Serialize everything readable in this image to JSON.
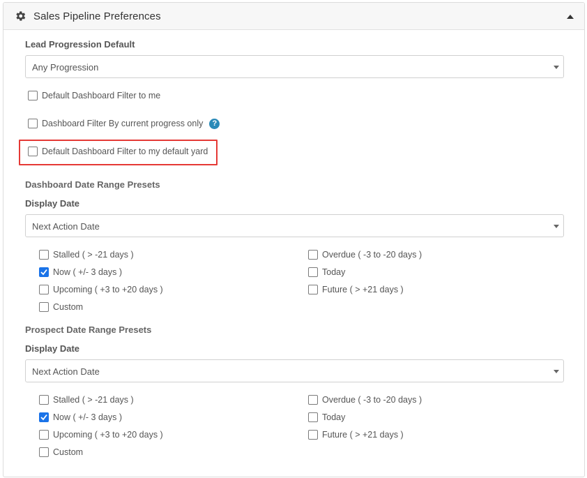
{
  "panel": {
    "title": "Sales Pipeline Preferences"
  },
  "lead_progression": {
    "label": "Lead Progression Default",
    "selected": "Any Progression"
  },
  "options": {
    "filter_to_me": {
      "label": "Default Dashboard Filter to me",
      "checked": false
    },
    "filter_current_progress": {
      "label": "Dashboard Filter By current progress only",
      "checked": false,
      "help": "?"
    },
    "filter_default_yard": {
      "label": "Default Dashboard Filter to my default yard",
      "checked": false
    }
  },
  "dashboard_presets": {
    "heading": "Dashboard Date Range Presets",
    "display_date_label": "Display Date",
    "display_date_selected": "Next Action Date",
    "items": [
      {
        "label": "Stalled ( > -21 days )",
        "checked": false
      },
      {
        "label": "Overdue ( -3 to -20 days )",
        "checked": false
      },
      {
        "label": "Now ( +/- 3 days )",
        "checked": true
      },
      {
        "label": "Today",
        "checked": false
      },
      {
        "label": "Upcoming ( +3 to +20 days )",
        "checked": false
      },
      {
        "label": "Future ( > +21 days )",
        "checked": false
      },
      {
        "label": "Custom",
        "checked": false
      }
    ]
  },
  "prospect_presets": {
    "heading": "Prospect Date Range Presets",
    "display_date_label": "Display Date",
    "display_date_selected": "Next Action Date",
    "items": [
      {
        "label": "Stalled ( > -21 days )",
        "checked": false
      },
      {
        "label": "Overdue ( -3 to -20 days )",
        "checked": false
      },
      {
        "label": "Now ( +/- 3 days )",
        "checked": true
      },
      {
        "label": "Today",
        "checked": false
      },
      {
        "label": "Upcoming ( +3 to +20 days )",
        "checked": false
      },
      {
        "label": "Future ( > +21 days )",
        "checked": false
      },
      {
        "label": "Custom",
        "checked": false
      }
    ]
  },
  "icons": {
    "header": "gear-icon",
    "collapse": "caret-up-icon",
    "select": "caret-down-icon",
    "help": "question-circle-icon",
    "check": "checkmark-icon"
  },
  "colors": {
    "checkbox_checked": "#1a73e8",
    "help_icon": "#2a8ab8",
    "highlight_border": "#e53935"
  }
}
